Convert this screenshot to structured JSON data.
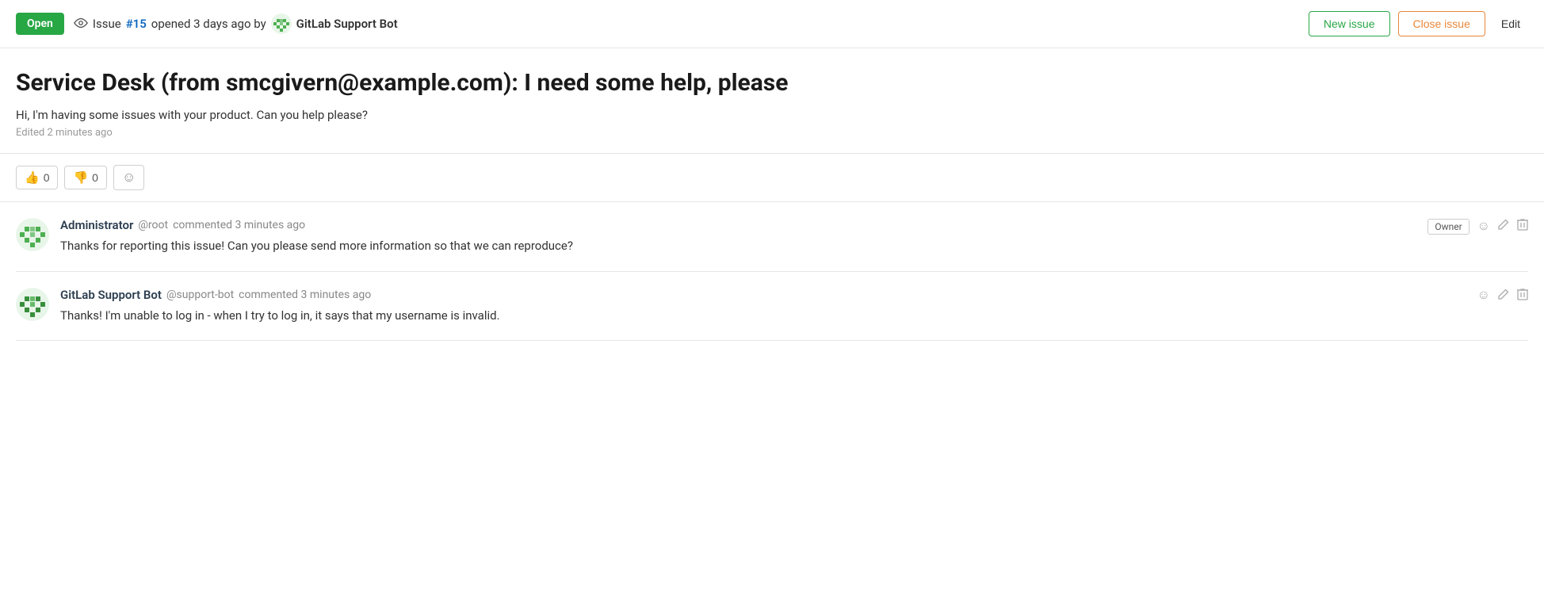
{
  "header": {
    "status": "Open",
    "issue_prefix": "Issue",
    "issue_number": "#15",
    "issue_meta": "opened 3 days ago by",
    "bot_name": "GitLab Support Bot",
    "new_issue_label": "New issue",
    "close_issue_label": "Close issue",
    "edit_label": "Edit"
  },
  "issue": {
    "title": "Service Desk (from smcgivern@example.com): I need some help, please",
    "description": "Hi, I'm having some issues with your product. Can you help please?",
    "edited_text": "Edited 2 minutes ago"
  },
  "reactions": {
    "thumbs_up_emoji": "👍",
    "thumbs_up_count": "0",
    "thumbs_down_emoji": "👎",
    "thumbs_down_count": "0",
    "add_emoji": "☺"
  },
  "comments": [
    {
      "author": "Administrator",
      "username": "@root",
      "action": "commented",
      "time": "3 minutes ago",
      "text": "Thanks for reporting this issue! Can you please send more information so that we can reproduce?",
      "role": "Owner",
      "is_admin": true
    },
    {
      "author": "GitLab Support Bot",
      "username": "@support-bot",
      "action": "commented",
      "time": "3 minutes ago",
      "text": "Thanks! I'm unable to log in - when I try to log in, it says that my username is invalid.",
      "role": "",
      "is_admin": false
    }
  ],
  "colors": {
    "open_green": "#28a745",
    "issue_number_blue": "#1068bf",
    "close_orange": "#e8873a"
  }
}
